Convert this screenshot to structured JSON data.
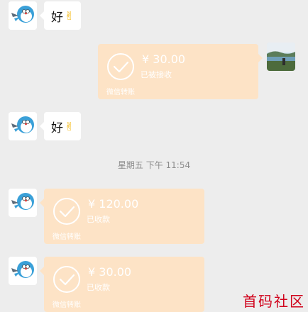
{
  "messages": [
    {
      "type": "text",
      "text": "好",
      "emoji": "ok-hand"
    },
    {
      "type": "transfer",
      "amount": "¥ 30.00",
      "status": "已被接收",
      "footer": "微信转账"
    },
    {
      "type": "text",
      "text": "好",
      "emoji": "ok-hand"
    },
    {
      "type": "transfer",
      "amount": "¥ 120.00",
      "status": "已收款",
      "footer": "微信转账"
    },
    {
      "type": "transfer",
      "amount": "¥ 30.00",
      "status": "已收款",
      "footer": "微信转账"
    }
  ],
  "timestamp": "星期五 下午 11:54",
  "watermark": "首码社区",
  "colors": {
    "background": "#ededed",
    "transfer_accepted": "#fde3c6",
    "bubble": "#ffffff",
    "watermark": "#d0021b"
  }
}
